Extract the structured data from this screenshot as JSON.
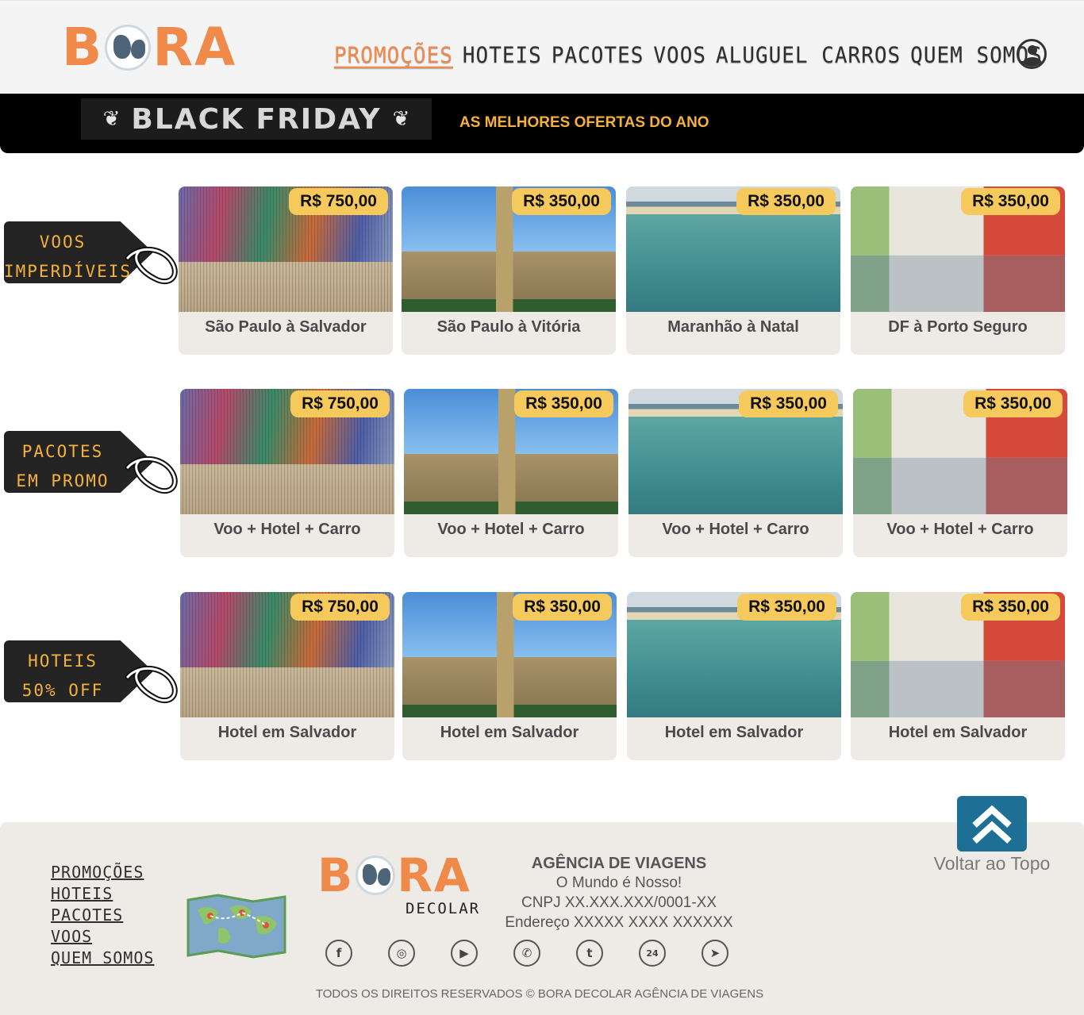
{
  "header": {
    "logo_text_left": "B",
    "logo_text_right": "RA",
    "nav": [
      {
        "label": "PROMOÇÕES",
        "active": true
      },
      {
        "label": "HOTEIS"
      },
      {
        "label": "PACOTES"
      },
      {
        "label": "VOOS"
      },
      {
        "label": "ALUGUEL CARROS"
      },
      {
        "label": "QUEM SOMOS"
      }
    ],
    "user_icon": "user-icon"
  },
  "banner": {
    "title": "BLACK FRIDAY",
    "slogan": "AS MELHORES OFERTAS DO ANO",
    "icon": "balloons-icon"
  },
  "colors": {
    "accent": "#f08a4b",
    "price_badge": "#f5c95b",
    "tag_text": "#f5b13c",
    "card_bg": "#eeebe6",
    "scroll_top_button": "#1d6f95"
  },
  "sections": [
    {
      "tag_line1": "VOOS",
      "tag_line2": "IMPERDÍVEIS",
      "cards": [
        {
          "price": "R$ 750,00",
          "title": "São Paulo  à Salvador",
          "image": "fitas-bonfim"
        },
        {
          "price": "R$ 350,00",
          "title": "São Paulo à Vitória",
          "image": "big-ben"
        },
        {
          "price": "R$ 350,00",
          "title": "Maranhão à Natal",
          "image": "beach"
        },
        {
          "price": "R$ 350,00",
          "title": "DF à Porto Seguro",
          "image": "recife-buildings"
        }
      ]
    },
    {
      "tag_line1": "PACOTES",
      "tag_line2": "EM PROMO",
      "cards": [
        {
          "price": "R$ 750,00",
          "title": "Voo + Hotel + Carro",
          "image": "fitas-bonfim"
        },
        {
          "price": "R$ 350,00",
          "title": "Voo + Hotel + Carro",
          "image": "big-ben"
        },
        {
          "price": "R$ 350,00",
          "title": "Voo + Hotel + Carro",
          "image": "beach"
        },
        {
          "price": "R$ 350,00",
          "title": "Voo + Hotel + Carro",
          "image": "recife-buildings"
        }
      ]
    },
    {
      "tag_line1": "HOTEIS",
      "tag_line2": "50% OFF",
      "cards": [
        {
          "price": "R$ 750,00",
          "title": "Hotel em Salvador",
          "image": "fitas-bonfim"
        },
        {
          "price": "R$ 350,00",
          "title": "Hotel em Salvador",
          "image": "big-ben"
        },
        {
          "price": "R$ 350,00",
          "title": "Hotel em Salvador",
          "image": "beach"
        },
        {
          "price": "R$ 350,00",
          "title": "Hotel em Salvador",
          "image": "recife-buildings"
        }
      ]
    }
  ],
  "scroll_top": {
    "label": "Voltar ao Topo",
    "icon": "double-chevron-up-icon"
  },
  "footer": {
    "links": [
      "PROMOÇÕES",
      "HOTEIS",
      "PACOTES",
      "VOOS",
      "QUEM SOMOS"
    ],
    "map_icon": "world-map-icon",
    "logo_sub": "DECOLAR",
    "agency_title": "AGÊNCIA DE VIAGENS",
    "agency_lines": [
      "O Mundo é Nosso!",
      "CNPJ XX.XXX.XXX/0001-XX",
      "Endereço XXXXX XXXX XXXXXX"
    ],
    "socials": [
      {
        "icon": "facebook-icon",
        "glyph": "f"
      },
      {
        "icon": "instagram-icon",
        "glyph": "◎"
      },
      {
        "icon": "youtube-icon",
        "glyph": "▶"
      },
      {
        "icon": "whatsapp-icon",
        "glyph": "✆"
      },
      {
        "icon": "twitter-icon",
        "glyph": "t"
      },
      {
        "icon": "phone-24h-icon",
        "glyph": "24"
      },
      {
        "icon": "telegram-icon",
        "glyph": "➤"
      }
    ],
    "copyright": "TODOS OS DIREITOS RESERVADOS © BORA DECOLAR AGÊNCIA DE VIAGENS"
  }
}
